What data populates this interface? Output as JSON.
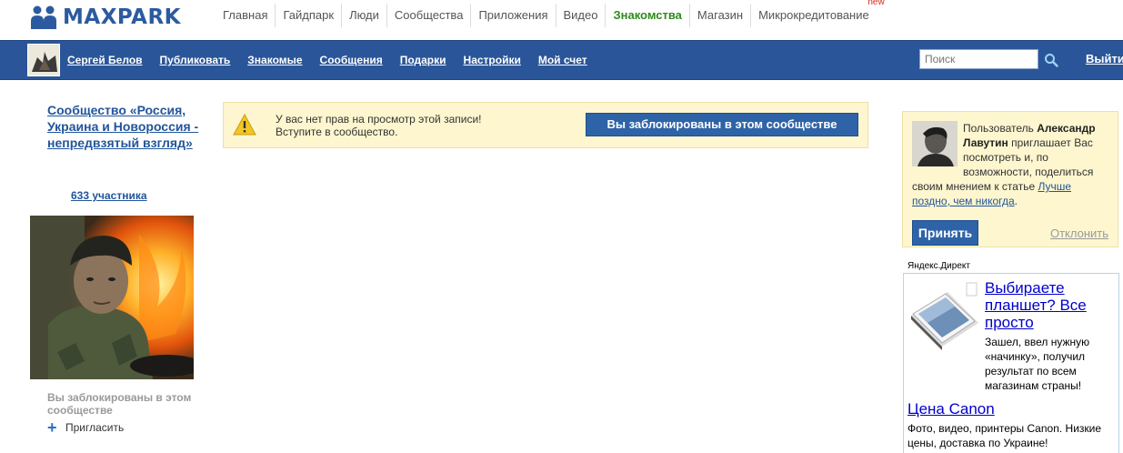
{
  "brand": {
    "name": "MAXPARK",
    "color": "#2c5aa0"
  },
  "top_nav": {
    "items": [
      {
        "label": "Главная"
      },
      {
        "label": "Гайдпарк"
      },
      {
        "label": "Люди"
      },
      {
        "label": "Сообщества"
      },
      {
        "label": "Приложения"
      },
      {
        "label": "Видео"
      },
      {
        "label": "Знакомства",
        "active": true
      },
      {
        "label": "Магазин"
      },
      {
        "label": "Микрокредитование",
        "badge": "new"
      }
    ],
    "active_color": "#2f8a1e"
  },
  "user_bar": {
    "background": "#2a5699",
    "user_name": "Сергей Белов",
    "links": [
      "Публиковать",
      "Знакомые",
      "Сообщения",
      "Подарки",
      "Настройки",
      "Мой счет"
    ],
    "search_placeholder": "Поиск",
    "search_icon": "search-icon",
    "exit_label": "Выйти"
  },
  "community": {
    "title": "Сообщество «Россия, Украина и Новороссия - непредвзятый взгляд»",
    "members": "633 участника",
    "blocked_note": "Вы заблокированы в этом сообществе",
    "invite_label": "Пригласить"
  },
  "notice": {
    "line1": "У вас нет прав на просмотр этой записи!",
    "line2": "Вступите в сообщество.",
    "button": "Вы заблокированы в этом сообществе",
    "icon": "warning-icon"
  },
  "invitation": {
    "prefix": "Пользователь ",
    "user": "Александр Лавутин",
    "text": " приглашает Вас посмотреть и, по возможности, поделиться своим мнением к статье ",
    "article": "Лучше поздно, чем никогда",
    "suffix": ".",
    "accept": "Принять",
    "decline": "Отклонить"
  },
  "ads": {
    "label": "Яндекс.Директ",
    "items": [
      {
        "title": "Выбираете планшет? Все просто",
        "text": "Зашел, ввел нужную «начинку», получил результат по всем магазинам страны!"
      },
      {
        "title": "Цена Canon",
        "text": "Фото, видео, принтеры Canon. Низкие цены, доставка по Украине!"
      }
    ]
  }
}
